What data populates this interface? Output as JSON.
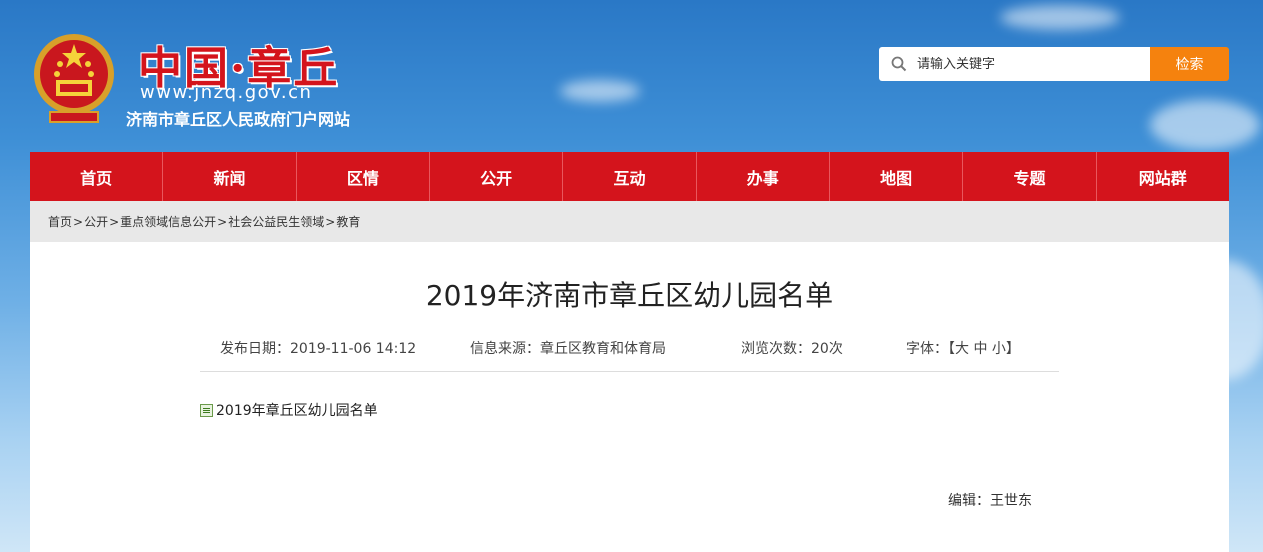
{
  "header": {
    "logo_title": "中国·章丘",
    "logo_url": "www.jnzq.gov.cn",
    "logo_subtitle": "济南市章丘区人民政府门户网站"
  },
  "search": {
    "placeholder": "请输入关键字",
    "button_label": "检索"
  },
  "nav": {
    "items": [
      "首页",
      "新闻",
      "区情",
      "公开",
      "互动",
      "办事",
      "地图",
      "专题",
      "网站群"
    ]
  },
  "breadcrumb": {
    "items": [
      "首页",
      "公开",
      "重点领域信息公开",
      "社会公益民生领域",
      "教育"
    ],
    "separator": ">"
  },
  "article": {
    "title": "2019年济南市章丘区幼儿园名单",
    "publish_date": "发布日期：2019-11-06 14:12",
    "source": "信息来源：章丘区教育和体育局",
    "views": "浏览次数：20次",
    "font_label": "字体：",
    "font_open": "【",
    "font_large": "大",
    "font_medium": "中",
    "font_small": "小",
    "font_close": "】",
    "attachment_name": "2019年章丘区幼儿园名单",
    "editor": "编辑：王世东"
  },
  "colors": {
    "nav_red": "#d4141c",
    "search_orange": "#f5820e",
    "sky_blue": "#3e8fd6"
  }
}
